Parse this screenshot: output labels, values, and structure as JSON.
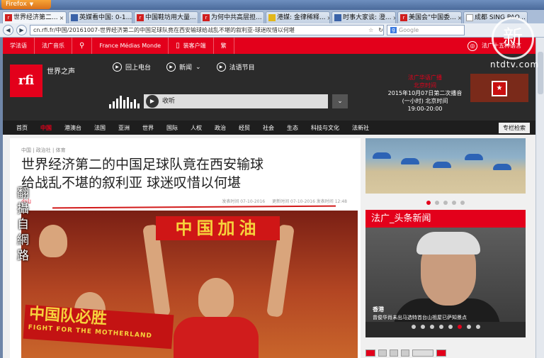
{
  "browser": {
    "menu_label": "Firefox",
    "tabs": [
      {
        "favicon": "rfi",
        "label": "世界经济第二..."
      },
      {
        "favicon": "blue",
        "label": "英媒看中国: 0-1..."
      },
      {
        "favicon": "rfi",
        "label": "中国鞋坊用大量..."
      },
      {
        "favicon": "rfi",
        "label": "为何中共高层担..."
      },
      {
        "favicon": "yellow",
        "label": "港媒: 金律稀释..."
      },
      {
        "favicon": "blue",
        "label": "时事大家谈: 澄..."
      },
      {
        "favicon": "rfi",
        "label": "美国会\"中国委..."
      },
      {
        "favicon": "white",
        "label": "成都 SING PAO..."
      }
    ],
    "url": "cn.rfi.fr/中国/20161007-世界经济第二的中国足球队竟在西安输球给战乱不堪的叙利亚-球迷叹惜以何堪",
    "search_placeholder": "Google"
  },
  "overlay": {
    "ntd_logo_glyph": "新",
    "ntd_text": "ntdtv.com",
    "vertical_caption": "翻攝自網路"
  },
  "topbar": {
    "items": [
      "学法语",
      "法广音乐",
      "France Médias Monde",
      "装客户端",
      "繁"
    ],
    "right_label": "法广十五种语言"
  },
  "header": {
    "logo_text": "rfi",
    "station_name": "世界之声",
    "nav": [
      "回上电台",
      "新闻",
      "法语节目"
    ],
    "player_label": "收听",
    "schedule": {
      "line1": "法广华语广播",
      "line2": "北京时间",
      "line3": "2015年10月07日第二次播音",
      "line4": "(一小时) 北京时间",
      "line5": "19:00-20:00"
    }
  },
  "mainnav": {
    "items": [
      "首页",
      "中国",
      "港澳台",
      "法国",
      "亚洲",
      "世界",
      "国际",
      "人权",
      "政治",
      "经贸",
      "社会",
      "生态",
      "科技与文化",
      "法新社"
    ],
    "active_index": 1,
    "special": "专栏检索"
  },
  "article": {
    "breadcrumb": "中国 | 政治社 | 体育",
    "headline_line1": "世界经济第二的中国足球队竟在西安输球",
    "headline_line2": "给战乱不堪的叙利亚 球迷叹惜以何堪",
    "author": "小山",
    "published": "发表时间 07-10-2016",
    "updated": "更新时间 07-10-2016 发表时间 12:48",
    "photo_banner_top": "中国加油",
    "photo_banner_bottom": "中国队必胜",
    "photo_banner_bottom_en": "FIGHT FOR THE MOTHERLAND"
  },
  "sidebar": {
    "slide_count": 5,
    "slide_active": 0,
    "headlines_title": "法广_头条新闻",
    "caption_place": "香港",
    "caption_text": "曾俊华肖未出马选特首台山祖屋已萨知景点",
    "headline_slide_count": 8,
    "headline_slide_active": 5
  },
  "colors": {
    "rfi_red": "#e3001b",
    "header_dark": "#2b2b2b",
    "banner_yellow": "#f6d23c"
  }
}
